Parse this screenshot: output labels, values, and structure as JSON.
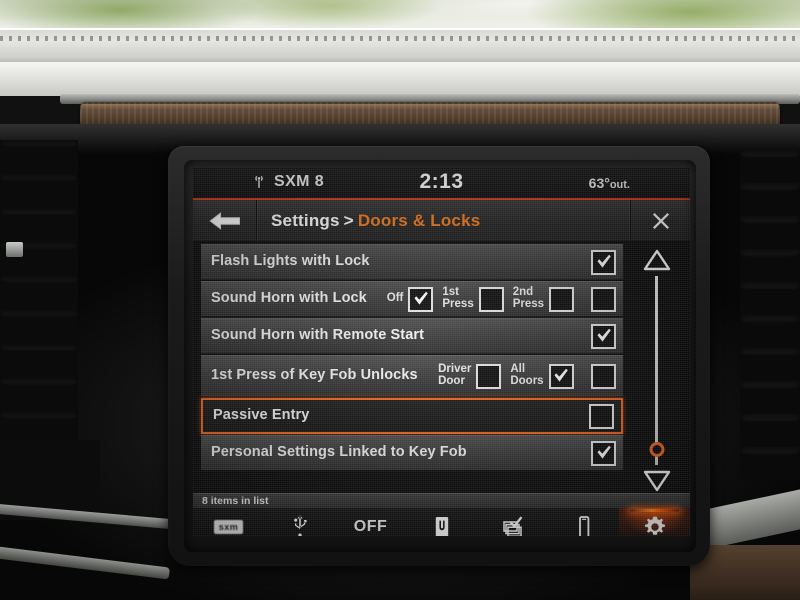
{
  "screen": {
    "status": {
      "source_icon": "satellite-radio-icon",
      "source": "SXM 8",
      "clock": "2:13",
      "temperature": "63°",
      "temperature_unit": "out.",
      "accent": "#d6361a"
    },
    "titlebar": {
      "back_icon": "back-arrow-icon",
      "crumb_root": "Settings",
      "crumb_separator": ">",
      "crumb_leaf": "Doors & Locks",
      "close_icon": "close-icon",
      "leaf_color": "#f07818"
    },
    "list": {
      "count_text": "8 items in list",
      "selected_color": "#f0641e",
      "rows": [
        {
          "label": "Flash Lights with Lock",
          "selected": false,
          "options": [],
          "end_checkbox": true
        },
        {
          "label": "Sound Horn with Lock",
          "selected": false,
          "options": [
            {
              "label": "Off",
              "checked": true
            },
            {
              "label": "1st\nPress",
              "checked": false
            },
            {
              "label": "2nd\nPress",
              "checked": false
            }
          ],
          "end_checkbox": false
        },
        {
          "label": "Sound Horn with Remote Start",
          "selected": false,
          "options": [],
          "end_checkbox": true
        },
        {
          "label": "1st Press of Key Fob Unlocks",
          "selected": false,
          "options": [
            {
              "label": "Driver\nDoor",
              "checked": false
            },
            {
              "label": "All\nDoors",
              "checked": true
            }
          ],
          "end_checkbox": false
        },
        {
          "label": "Passive Entry",
          "selected": true,
          "options": [],
          "end_checkbox": false
        },
        {
          "label": "Personal Settings Linked to Key Fob",
          "selected": false,
          "options": [],
          "end_checkbox": true
        }
      ]
    },
    "scrollbar": {
      "up_icon": "scroll-up-triangle-icon",
      "down_icon": "scroll-down-triangle-icon",
      "thumb_position_percent": 88
    },
    "navbar": {
      "items": [
        {
          "label": "Radio",
          "icon": "sxm-logo-icon",
          "icon_text": "sxm",
          "active": false
        },
        {
          "label": "Media",
          "icon": "usb-icon",
          "icon_text": "",
          "active": false
        },
        {
          "label": "Climate",
          "icon": "climate-off-icon",
          "icon_text": "OFF",
          "active": false
        },
        {
          "label": "Apps",
          "icon": "uconnect-u-icon",
          "icon_text": "",
          "active": false
        },
        {
          "label": "Controls",
          "icon": "controls-icon",
          "icon_text": "",
          "active": false
        },
        {
          "label": "Phone",
          "icon": "phone-handset-icon",
          "icon_text": "",
          "active": false
        },
        {
          "label": "Settings",
          "icon": "gear-icon",
          "icon_text": "",
          "active": true
        }
      ],
      "active_color": "#f2561c"
    }
  }
}
